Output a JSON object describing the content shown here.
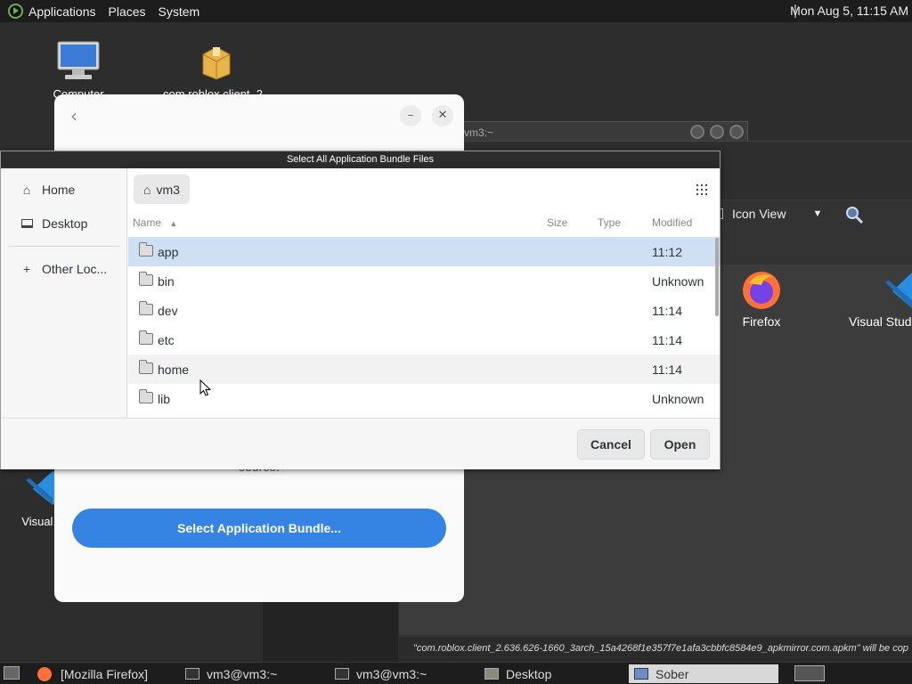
{
  "top_panel": {
    "menus": [
      "Applications",
      "Places",
      "System"
    ],
    "clock": "Mon Aug  5, 11:15 AM"
  },
  "desktop": {
    "icons": [
      {
        "label": "Computer",
        "icon": "computer-icon"
      },
      {
        "label": "com.roblox.client_2...",
        "icon": "package-icon"
      },
      {
        "label": "Visual S",
        "icon": "vscode-icon"
      }
    ]
  },
  "bg_window": {
    "terminal_title": "vm3:~",
    "view_mode": "Icon View",
    "items": [
      {
        "label": "Firefox",
        "icon": "firefox-icon"
      },
      {
        "label": "Visual Stud",
        "icon": "vscode-icon"
      }
    ],
    "status": "\"com.roblox.client_2.636.626-1660_3arch_15a4268f1e357f7e1afa3cbbfc8584e9_apkmirror.com.apkm\" will be cop"
  },
  "sober": {
    "hint_text": "source.",
    "primary_button": "Select Application Bundle..."
  },
  "dialog": {
    "title": "Select All Application Bundle Files",
    "sidebar": [
      {
        "label": "Home",
        "icon": "home-icon"
      },
      {
        "label": "Desktop",
        "icon": "desktop-icon"
      },
      {
        "label": "Other Loc...",
        "icon": "plus-icon"
      }
    ],
    "path": "vm3",
    "columns": {
      "name": "Name",
      "size": "Size",
      "type": "Type",
      "modified": "Modified"
    },
    "files": [
      {
        "name": "app",
        "modified": "11:12",
        "selected": true
      },
      {
        "name": "bin",
        "modified": "Unknown"
      },
      {
        "name": "dev",
        "modified": "11:14"
      },
      {
        "name": "etc",
        "modified": "11:14"
      },
      {
        "name": "home",
        "modified": "11:14",
        "hover": true
      },
      {
        "name": "lib",
        "modified": "Unknown"
      }
    ],
    "cancel_label": "Cancel",
    "open_label": "Open"
  },
  "taskbar": {
    "tasks": [
      {
        "label": "[Mozilla Firefox]",
        "icon": "firefox-icon"
      },
      {
        "label": "vm3@vm3:~",
        "icon": "terminal-icon"
      },
      {
        "label": "vm3@vm3:~",
        "icon": "terminal-icon"
      },
      {
        "label": "Desktop",
        "icon": "folder-icon"
      },
      {
        "label": "Sober",
        "icon": "window-icon",
        "active": true
      }
    ]
  },
  "colors": {
    "accent": "#3584e4",
    "selection": "#cfe0f4",
    "panel": "#1d1d1d"
  }
}
